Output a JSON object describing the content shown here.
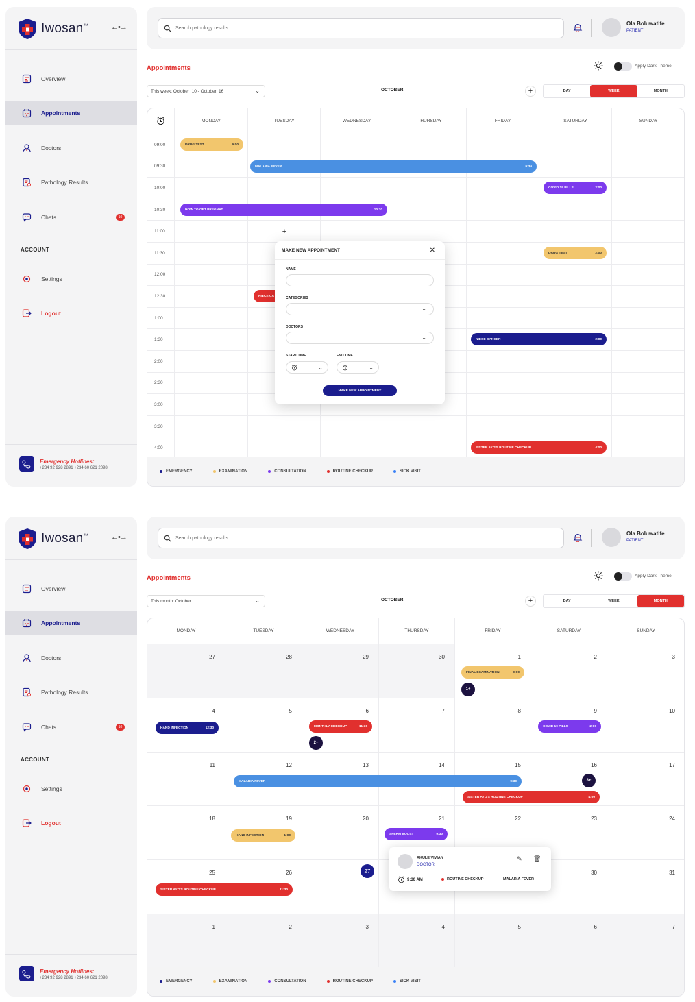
{
  "app": {
    "name": "Iwosan",
    "tm": "™"
  },
  "colors": {
    "accent": "#e1302e",
    "navy": "#1b1d8e",
    "emergency": "#1b1d8e",
    "examination": "#f2c66d",
    "consultation": "#7c3aed",
    "routine_checkup": "#e1302e",
    "sick_visit": "#3b82f6",
    "malaria": "#4a90e2"
  },
  "sidebar": {
    "items": [
      {
        "label": "Overview",
        "icon": "overview-icon"
      },
      {
        "label": "Appointments",
        "icon": "calendar-icon"
      },
      {
        "label": "Doctors",
        "icon": "doctor-icon"
      },
      {
        "label": "Pathology Results",
        "icon": "pathology-icon"
      },
      {
        "label": "Chats",
        "icon": "chat-icon",
        "badge": "10"
      }
    ],
    "account_heading": "ACCOUNT",
    "settings": "Settings",
    "logout": "Logout",
    "hotline_title": "Emergency Hotlines:",
    "hotline_numbers": "+234 92 928 2891  +234 60 621 2098"
  },
  "header": {
    "search_placeholder": "Search pathology results",
    "user_name": "Ola Boluwatife",
    "user_role": "PATIENT"
  },
  "page": {
    "title": "Appointments",
    "dark_theme_label": "Apply Dark Theme",
    "month_label": "OCTOBER",
    "views": [
      "DAY",
      "WEEK",
      "MONTH"
    ]
  },
  "legend": [
    "EMERGENCY",
    "EXAMINATION",
    "CONSULTATION",
    "ROUTINE CHECKUP",
    "SICK VISIT"
  ],
  "week_view": {
    "period": "This week: October ,10 - October, 16",
    "days": [
      "MONDAY",
      "TUESDAY",
      "WEDNESDAY",
      "THURSDAY",
      "FRIDAY",
      "SATURDAY",
      "SUNDAY"
    ],
    "times": [
      "09:00",
      "09:30",
      "10:00",
      "10:30",
      "11:00",
      "11:30",
      "12:00",
      "12:30",
      "1:00",
      "1:30",
      "2:00",
      "2:30",
      "3:00",
      "3:30",
      "4:00"
    ],
    "events": [
      {
        "label": "DRUG TEST",
        "time": "9:00"
      },
      {
        "label": "MALARIA FEVER",
        "time": "9:30"
      },
      {
        "label": "COVID 19 PILLS",
        "time": "2:00"
      },
      {
        "label": "HOW TO GET PREGNAT",
        "time": "10:30"
      },
      {
        "label": "DRUG TEST",
        "time": "2:00"
      },
      {
        "label": "NIECE CA",
        "time": ""
      },
      {
        "label": "NIECE CANCER",
        "time": "2:00"
      },
      {
        "label": "SISTER AYO'S ROUTINE CHECKUP",
        "time": "4:00"
      }
    ],
    "modal": {
      "title": "MAKE NEW APPOINTMENT",
      "name_label": "NAME",
      "categories_label": "CATEGORIES",
      "doctors_label": "DOCTORS",
      "start_label": "START TIME",
      "end_label": "END TIME",
      "submit": "MAKE NEW APPOINTMENT"
    }
  },
  "month_view": {
    "period": "This month: October",
    "days": [
      "MONDAY",
      "TUESDAY",
      "WEDNESDAY",
      "THURSDAY",
      "FRIDAY",
      "SATURDAY",
      "SUNDAY"
    ],
    "weeks": [
      [
        "27",
        "28",
        "29",
        "30",
        "1",
        "2",
        "3"
      ],
      [
        "4",
        "5",
        "6",
        "7",
        "8",
        "9",
        "10"
      ],
      [
        "11",
        "12",
        "13",
        "14",
        "15",
        "16",
        "17"
      ],
      [
        "18",
        "19",
        "20",
        "21",
        "22",
        "23",
        "24"
      ],
      [
        "25",
        "26",
        "27",
        "28",
        "29",
        "30",
        "31"
      ],
      [
        "1",
        "2",
        "3",
        "4",
        "5",
        "6",
        "7"
      ]
    ],
    "events": [
      {
        "label": "FINAL EXAMINATION",
        "time": "9:00"
      },
      {
        "label": "HAND INFECTION",
        "time": "12:30"
      },
      {
        "label": "MONTHLY CHECKUP",
        "time": "11:30"
      },
      {
        "label": "COVID 19 PILLS",
        "time": "2:00"
      },
      {
        "label": "MALARIA FEVER",
        "time": "9:30"
      },
      {
        "label": "SISTER AYO'S ROUTINE CHECKUP",
        "time": "4:00"
      },
      {
        "label": "HAND INFECTION",
        "time": "1:00"
      },
      {
        "label": "SPERM BOOST",
        "time": "9:30"
      },
      {
        "label": "SISTER AYO'S ROUTINE CHECKUP",
        "time": "11:30"
      }
    ],
    "more": [
      "1+",
      "2+",
      "3+"
    ],
    "popup": {
      "name": "AKULE VIVIAN",
      "role": "DOCTOR",
      "time": "9:30 AM",
      "category": "ROUTINE CHECKUP",
      "event": "MALARIA FEVER"
    }
  }
}
